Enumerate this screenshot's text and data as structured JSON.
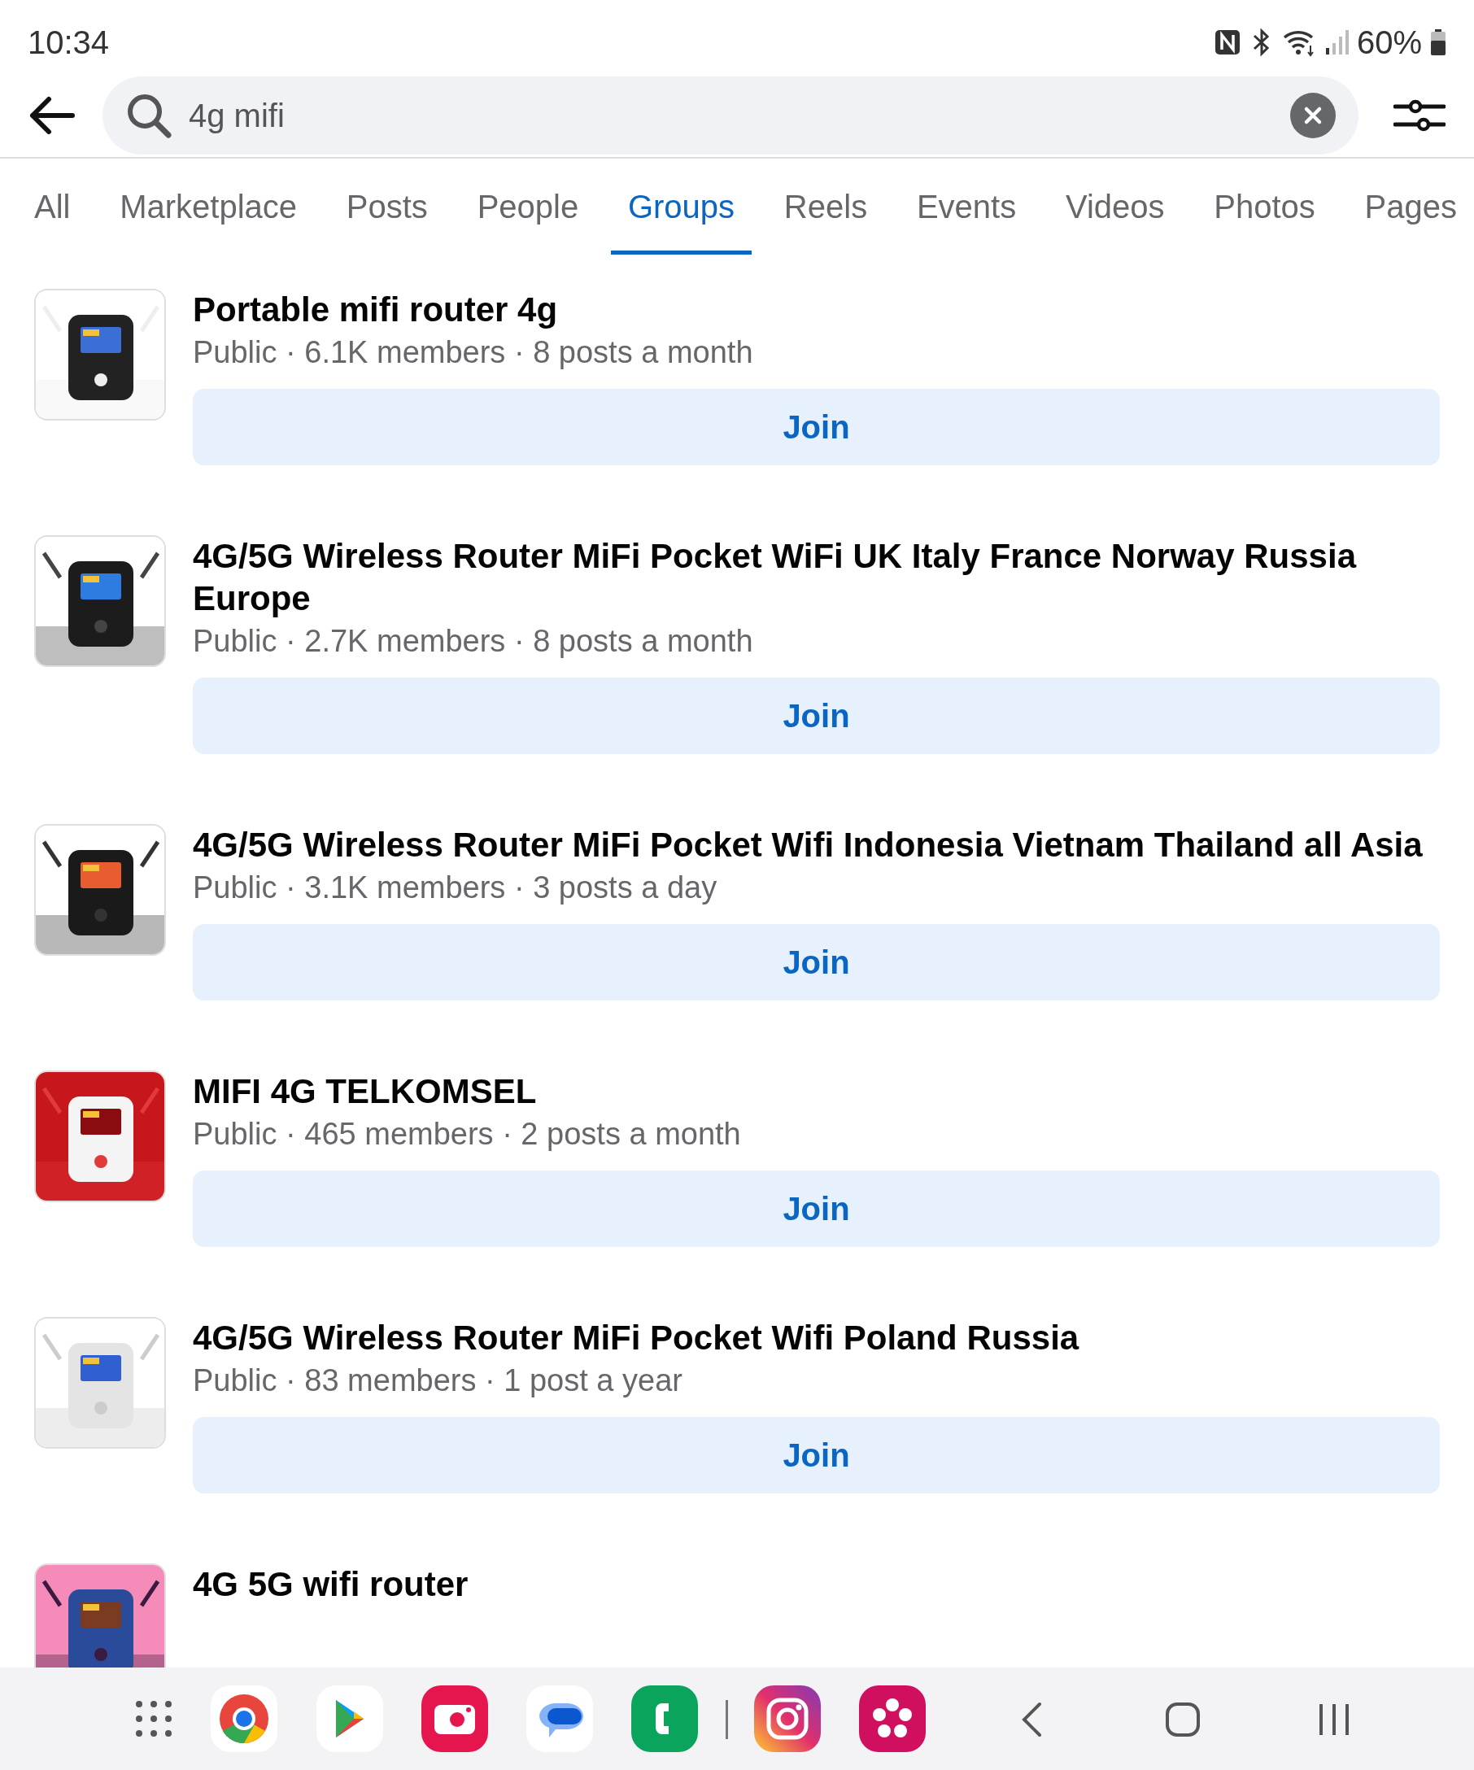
{
  "status_bar": {
    "time": "10:34",
    "battery": "60%"
  },
  "search": {
    "value": "4g mifi"
  },
  "tabs": [
    {
      "label": "All",
      "selected": false
    },
    {
      "label": "Marketplace",
      "selected": false
    },
    {
      "label": "Posts",
      "selected": false
    },
    {
      "label": "People",
      "selected": false
    },
    {
      "label": "Groups",
      "selected": true
    },
    {
      "label": "Reels",
      "selected": false
    },
    {
      "label": "Events",
      "selected": false
    },
    {
      "label": "Videos",
      "selected": false
    },
    {
      "label": "Photos",
      "selected": false
    },
    {
      "label": "Pages",
      "selected": false
    }
  ],
  "groups": [
    {
      "title": "Portable mifi router 4g",
      "meta": "Public · 6.1K members · 8 posts a month",
      "button": "Join"
    },
    {
      "title": "4G/5G Wireless Router MiFi Pocket WiFi UK Italy France Norway Russia Europe",
      "meta": "Public · 2.7K members · 8 posts a month",
      "button": "Join"
    },
    {
      "title": "4G/5G Wireless Router MiFi Pocket Wifi Indonesia Vietnam Thailand  all Asia",
      "meta": "Public · 3.1K members · 3 posts a day",
      "button": "Join"
    },
    {
      "title": "MIFI 4G TELKOMSEL",
      "meta": "Public · 465 members · 2 posts a month",
      "button": "Join"
    },
    {
      "title": "4G/5G Wireless Router MiFi Pocket Wifi Poland Russia",
      "meta": "Public · 83 members · 1 post a year",
      "button": "Join"
    },
    {
      "title": "4G 5G wifi router"
    }
  ]
}
